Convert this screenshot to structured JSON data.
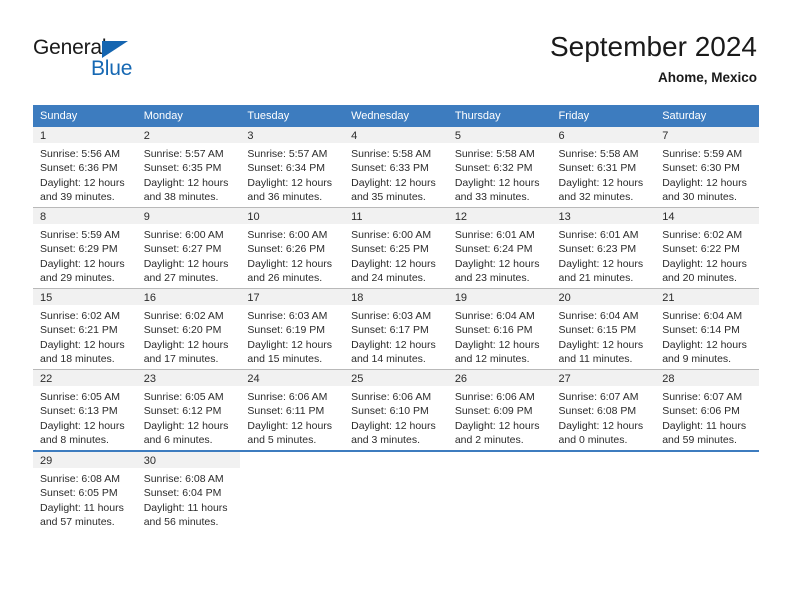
{
  "brand": {
    "name_part1": "General",
    "name_part2": "Blue",
    "triangle_color": "#1565b0",
    "blue_color": "#1668b3"
  },
  "header": {
    "title": "September 2024",
    "location": "Ahome, Mexico",
    "header_bg_color": "#3d7cbf",
    "header_text_color": "#ffffff"
  },
  "weekdays": [
    "Sunday",
    "Monday",
    "Tuesday",
    "Wednesday",
    "Thursday",
    "Friday",
    "Saturday"
  ],
  "weeks": [
    {
      "days": [
        {
          "num": "1",
          "sunrise": "Sunrise: 5:56 AM",
          "sunset": "Sunset: 6:36 PM",
          "daylight1": "Daylight: 12 hours",
          "daylight2": "and 39 minutes."
        },
        {
          "num": "2",
          "sunrise": "Sunrise: 5:57 AM",
          "sunset": "Sunset: 6:35 PM",
          "daylight1": "Daylight: 12 hours",
          "daylight2": "and 38 minutes."
        },
        {
          "num": "3",
          "sunrise": "Sunrise: 5:57 AM",
          "sunset": "Sunset: 6:34 PM",
          "daylight1": "Daylight: 12 hours",
          "daylight2": "and 36 minutes."
        },
        {
          "num": "4",
          "sunrise": "Sunrise: 5:58 AM",
          "sunset": "Sunset: 6:33 PM",
          "daylight1": "Daylight: 12 hours",
          "daylight2": "and 35 minutes."
        },
        {
          "num": "5",
          "sunrise": "Sunrise: 5:58 AM",
          "sunset": "Sunset: 6:32 PM",
          "daylight1": "Daylight: 12 hours",
          "daylight2": "and 33 minutes."
        },
        {
          "num": "6",
          "sunrise": "Sunrise: 5:58 AM",
          "sunset": "Sunset: 6:31 PM",
          "daylight1": "Daylight: 12 hours",
          "daylight2": "and 32 minutes."
        },
        {
          "num": "7",
          "sunrise": "Sunrise: 5:59 AM",
          "sunset": "Sunset: 6:30 PM",
          "daylight1": "Daylight: 12 hours",
          "daylight2": "and 30 minutes."
        }
      ]
    },
    {
      "days": [
        {
          "num": "8",
          "sunrise": "Sunrise: 5:59 AM",
          "sunset": "Sunset: 6:29 PM",
          "daylight1": "Daylight: 12 hours",
          "daylight2": "and 29 minutes."
        },
        {
          "num": "9",
          "sunrise": "Sunrise: 6:00 AM",
          "sunset": "Sunset: 6:27 PM",
          "daylight1": "Daylight: 12 hours",
          "daylight2": "and 27 minutes."
        },
        {
          "num": "10",
          "sunrise": "Sunrise: 6:00 AM",
          "sunset": "Sunset: 6:26 PM",
          "daylight1": "Daylight: 12 hours",
          "daylight2": "and 26 minutes."
        },
        {
          "num": "11",
          "sunrise": "Sunrise: 6:00 AM",
          "sunset": "Sunset: 6:25 PM",
          "daylight1": "Daylight: 12 hours",
          "daylight2": "and 24 minutes."
        },
        {
          "num": "12",
          "sunrise": "Sunrise: 6:01 AM",
          "sunset": "Sunset: 6:24 PM",
          "daylight1": "Daylight: 12 hours",
          "daylight2": "and 23 minutes."
        },
        {
          "num": "13",
          "sunrise": "Sunrise: 6:01 AM",
          "sunset": "Sunset: 6:23 PM",
          "daylight1": "Daylight: 12 hours",
          "daylight2": "and 21 minutes."
        },
        {
          "num": "14",
          "sunrise": "Sunrise: 6:02 AM",
          "sunset": "Sunset: 6:22 PM",
          "daylight1": "Daylight: 12 hours",
          "daylight2": "and 20 minutes."
        }
      ]
    },
    {
      "days": [
        {
          "num": "15",
          "sunrise": "Sunrise: 6:02 AM",
          "sunset": "Sunset: 6:21 PM",
          "daylight1": "Daylight: 12 hours",
          "daylight2": "and 18 minutes."
        },
        {
          "num": "16",
          "sunrise": "Sunrise: 6:02 AM",
          "sunset": "Sunset: 6:20 PM",
          "daylight1": "Daylight: 12 hours",
          "daylight2": "and 17 minutes."
        },
        {
          "num": "17",
          "sunrise": "Sunrise: 6:03 AM",
          "sunset": "Sunset: 6:19 PM",
          "daylight1": "Daylight: 12 hours",
          "daylight2": "and 15 minutes."
        },
        {
          "num": "18",
          "sunrise": "Sunrise: 6:03 AM",
          "sunset": "Sunset: 6:17 PM",
          "daylight1": "Daylight: 12 hours",
          "daylight2": "and 14 minutes."
        },
        {
          "num": "19",
          "sunrise": "Sunrise: 6:04 AM",
          "sunset": "Sunset: 6:16 PM",
          "daylight1": "Daylight: 12 hours",
          "daylight2": "and 12 minutes."
        },
        {
          "num": "20",
          "sunrise": "Sunrise: 6:04 AM",
          "sunset": "Sunset: 6:15 PM",
          "daylight1": "Daylight: 12 hours",
          "daylight2": "and 11 minutes."
        },
        {
          "num": "21",
          "sunrise": "Sunrise: 6:04 AM",
          "sunset": "Sunset: 6:14 PM",
          "daylight1": "Daylight: 12 hours",
          "daylight2": "and 9 minutes."
        }
      ]
    },
    {
      "days": [
        {
          "num": "22",
          "sunrise": "Sunrise: 6:05 AM",
          "sunset": "Sunset: 6:13 PM",
          "daylight1": "Daylight: 12 hours",
          "daylight2": "and 8 minutes."
        },
        {
          "num": "23",
          "sunrise": "Sunrise: 6:05 AM",
          "sunset": "Sunset: 6:12 PM",
          "daylight1": "Daylight: 12 hours",
          "daylight2": "and 6 minutes."
        },
        {
          "num": "24",
          "sunrise": "Sunrise: 6:06 AM",
          "sunset": "Sunset: 6:11 PM",
          "daylight1": "Daylight: 12 hours",
          "daylight2": "and 5 minutes."
        },
        {
          "num": "25",
          "sunrise": "Sunrise: 6:06 AM",
          "sunset": "Sunset: 6:10 PM",
          "daylight1": "Daylight: 12 hours",
          "daylight2": "and 3 minutes."
        },
        {
          "num": "26",
          "sunrise": "Sunrise: 6:06 AM",
          "sunset": "Sunset: 6:09 PM",
          "daylight1": "Daylight: 12 hours",
          "daylight2": "and 2 minutes."
        },
        {
          "num": "27",
          "sunrise": "Sunrise: 6:07 AM",
          "sunset": "Sunset: 6:08 PM",
          "daylight1": "Daylight: 12 hours",
          "daylight2": "and 0 minutes."
        },
        {
          "num": "28",
          "sunrise": "Sunrise: 6:07 AM",
          "sunset": "Sunset: 6:06 PM",
          "daylight1": "Daylight: 11 hours",
          "daylight2": "and 59 minutes."
        }
      ]
    },
    {
      "days": [
        {
          "num": "29",
          "sunrise": "Sunrise: 6:08 AM",
          "sunset": "Sunset: 6:05 PM",
          "daylight1": "Daylight: 11 hours",
          "daylight2": "and 57 minutes."
        },
        {
          "num": "30",
          "sunrise": "Sunrise: 6:08 AM",
          "sunset": "Sunset: 6:04 PM",
          "daylight1": "Daylight: 11 hours",
          "daylight2": "and 56 minutes."
        },
        {
          "num": "",
          "sunrise": "",
          "sunset": "",
          "daylight1": "",
          "daylight2": ""
        },
        {
          "num": "",
          "sunrise": "",
          "sunset": "",
          "daylight1": "",
          "daylight2": ""
        },
        {
          "num": "",
          "sunrise": "",
          "sunset": "",
          "daylight1": "",
          "daylight2": ""
        },
        {
          "num": "",
          "sunrise": "",
          "sunset": "",
          "daylight1": "",
          "daylight2": ""
        },
        {
          "num": "",
          "sunrise": "",
          "sunset": "",
          "daylight1": "",
          "daylight2": ""
        }
      ]
    }
  ]
}
